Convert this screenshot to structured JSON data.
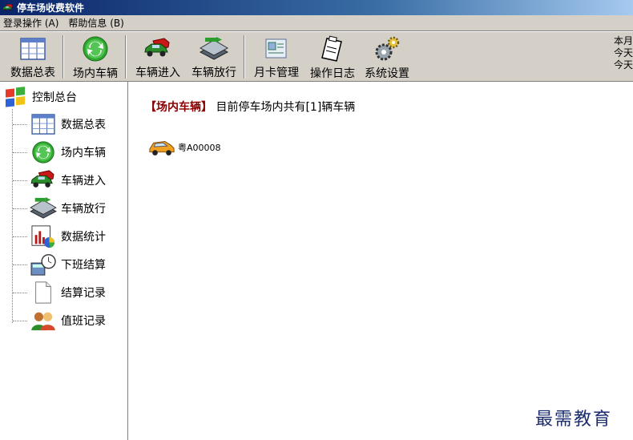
{
  "window": {
    "title": "停车场收费软件"
  },
  "menu": [
    {
      "label": "登录操作 (A)"
    },
    {
      "label": "帮助信息 (B)"
    }
  ],
  "toolbar": {
    "buttons": [
      {
        "label": "数据总表",
        "icon": "table-icon"
      },
      {
        "label": "场内车辆",
        "icon": "refresh-globe-icon"
      },
      {
        "label": "车辆进入",
        "icon": "car-enter-icon"
      },
      {
        "label": "车辆放行",
        "icon": "barrier-release-icon"
      },
      {
        "label": "月卡管理",
        "icon": "card-icon"
      },
      {
        "label": "操作日志",
        "icon": "clipboard-icon"
      },
      {
        "label": "系统设置",
        "icon": "gears-icon"
      }
    ],
    "status_lines": [
      "本月",
      "今天",
      "今天"
    ]
  },
  "sidebar": {
    "root": {
      "label": "控制总台",
      "icon": "windows-logo-icon"
    },
    "items": [
      {
        "label": "数据总表",
        "icon": "table-icon"
      },
      {
        "label": "场内车辆",
        "icon": "refresh-globe-icon"
      },
      {
        "label": "车辆进入",
        "icon": "car-enter-icon"
      },
      {
        "label": "车辆放行",
        "icon": "barrier-release-icon"
      },
      {
        "label": "数据统计",
        "icon": "chart-icon"
      },
      {
        "label": "下班结算",
        "icon": "calculator-clock-icon"
      },
      {
        "label": "结算记录",
        "icon": "document-icon"
      },
      {
        "label": "值班记录",
        "icon": "users-icon"
      }
    ]
  },
  "main": {
    "tag": "【场内车辆】",
    "summary": "目前停车场内共有[1]辆车辆",
    "vehicles": [
      {
        "plate": "粤A00008",
        "icon": "car-icon"
      }
    ]
  },
  "watermark": "最需教育",
  "colors": {
    "title_start": "#0a246a",
    "title_end": "#a6caf0",
    "tag": "#8b0000",
    "chrome": "#d4d0c8",
    "watermark": "#1c2d6e"
  }
}
